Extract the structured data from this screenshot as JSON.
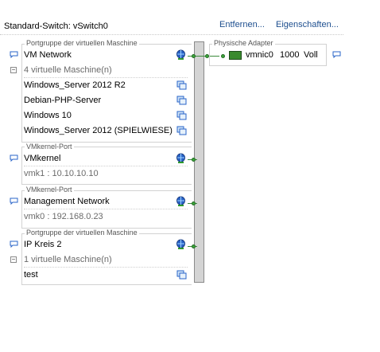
{
  "switch": {
    "title": "Standard-Switch: vSwitch0",
    "remove_link": "Entfernen...",
    "properties_link": "Eigenschaften..."
  },
  "portgroups": [
    {
      "type_label": "Portgruppe der virtuellen Maschine",
      "name": "VM Network",
      "vm_count_label": "4 virtuelle Maschine(n)",
      "vms": [
        "Windows_Server 2012 R2",
        "Debian-PHP-Server",
        "Windows 10",
        "Windows_Server 2012 (SPIELWIESE)"
      ]
    },
    {
      "type_label": "VMkernel-Port",
      "name": "VMkernel",
      "detail": "vmk1 : 10.10.10.10"
    },
    {
      "type_label": "VMkernel-Port",
      "name": "Management Network",
      "detail": "vmk0 : 192.168.0.23"
    },
    {
      "type_label": "Portgruppe der virtuellen Maschine",
      "name": "IP Kreis 2",
      "vm_count_label": "1 virtuelle Maschine(n)",
      "vms": [
        "test"
      ]
    }
  ],
  "physical": {
    "label": "Physische Adapter",
    "nic_name": "vmnic0",
    "speed": "1000",
    "duplex": "Voll"
  },
  "icons": {
    "comment": "speech-bubble-icon",
    "network": "globe-icon",
    "vm": "vm-icon",
    "nic": "network-card-icon",
    "collapse": "minus-icon"
  },
  "colors": {
    "link": "#1e4f8f",
    "connection": "#3c8a3c",
    "globe": "#2a64c8"
  }
}
